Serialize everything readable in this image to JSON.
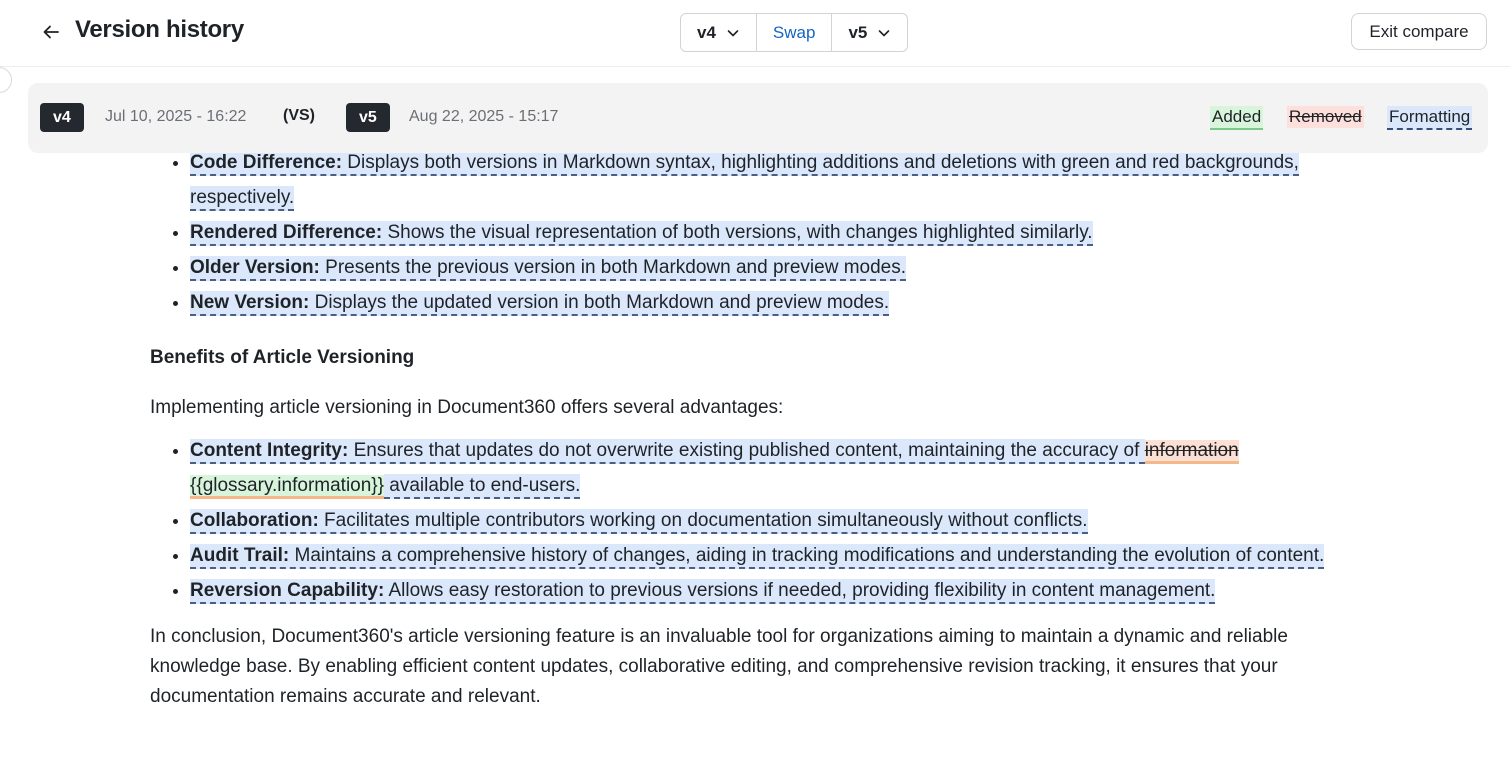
{
  "header": {
    "title": "Version history",
    "left_version": "v4",
    "swap_label": "Swap",
    "right_version": "v5",
    "exit_label": "Exit compare"
  },
  "compare_bar": {
    "left_badge": "v4",
    "left_date": "Jul 10, 2025 - 16:22",
    "vs_label": "(VS)",
    "right_badge": "v5",
    "right_date": "Aug 22, 2025 - 15:17",
    "legend": {
      "added": "Added",
      "removed": "Removed",
      "formatting": "Formatting"
    },
    "colors": {
      "added": "#d8f5dc",
      "removed": "#fde0dc",
      "formatting": "#dbe8fb"
    }
  },
  "content": {
    "list1": [
      {
        "bold": "Code Difference:",
        "text": " Displays both versions in Markdown syntax, highlighting additions and deletions with green and red backgrounds, respectively."
      },
      {
        "bold": "Rendered Difference:",
        "text": " Shows the visual representation of both versions, with changes highlighted similarly."
      },
      {
        "bold": "Older Version:",
        "text": " Presents the previous version in both Markdown and preview modes."
      },
      {
        "bold": "New Version:",
        "text": " Displays the updated version in both Markdown and preview modes."
      }
    ],
    "subheading": "Benefits of Article Versioning",
    "intro": "Implementing article versioning in Document360 offers several advantages:",
    "list2": {
      "integrity": {
        "bold": "Content Integrity:",
        "text_before": " Ensures that updates do not overwrite existing published content, maintaining the accuracy of ",
        "removed": "information",
        "added": "{{glossary.information}}",
        "text_after": " available to end-users."
      },
      "collaboration": {
        "bold": "Collaboration:",
        "text": " Facilitates multiple contributors working on documentation simultaneously without conflicts."
      },
      "audit": {
        "bold": "Audit Trail:",
        "text": " Maintains a comprehensive history of changes, aiding in tracking modifications and understanding the evolution of content."
      },
      "reversion": {
        "bold": "Reversion Capability:",
        "text": " Allows easy restoration to previous versions if needed, providing flexibility in content management."
      }
    },
    "conclusion": "In conclusion, Document360's article versioning feature is an invaluable tool for organizations aiming to maintain a dynamic and reliable knowledge base. By enabling efficient content updates, collaborative editing, and comprehensive revision tracking, it ensures that your documentation remains accurate and relevant."
  },
  "icons": {
    "back": "arrow-left-icon",
    "dropdown": "chevron-down-icon"
  }
}
